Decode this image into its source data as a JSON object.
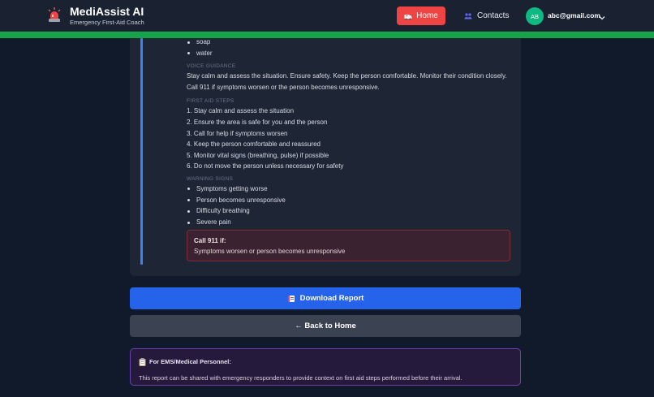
{
  "header": {
    "app_title": "MediAssist AI",
    "app_subtitle": "Emergency First-Aid Coach",
    "home_label": "Home",
    "contacts_label": "Contacts",
    "avatar_initials": "AB",
    "user_email": "abc@gmail.com"
  },
  "report": {
    "supplies": [
      "soap",
      "water"
    ],
    "voice_guidance": {
      "label": "VOICE GUIDANCE",
      "text": "Stay calm and assess the situation. Ensure safety. Keep the person comfortable. Monitor their condition closely. Call 911 if symptoms worsen or the person becomes unresponsive."
    },
    "first_aid": {
      "label": "FIRST AID STEPS",
      "steps": [
        "1. Stay calm and assess the situation",
        "2. Ensure the area is safe for you and the person",
        "3. Call for help if symptoms worsen",
        "4. Keep the person comfortable and reassured",
        "5. Monitor vital signs (breathing, pulse) if possible",
        "6. Do not move the person unless necessary for safety"
      ]
    },
    "warning_signs": {
      "label": "WARNING SIGNS",
      "items": [
        "Symptoms getting worse",
        "Person becomes unresponsive",
        "Difficulty breathing",
        "Severe pain"
      ]
    },
    "call_911": {
      "title": "Call 911 if:",
      "text": "Symptoms worsen or person becomes unresponsive"
    }
  },
  "actions": {
    "download_label": "Download Report",
    "back_label": "← Back to Home"
  },
  "ems": {
    "title": "For EMS/Medical Personnel:",
    "text": "This report can be shared with emergency responders to provide context on first aid steps performed before their arrival."
  },
  "icons": {
    "brand": "siren-icon",
    "home": "ambulance-icon",
    "contacts": "people-icon",
    "download": "book-icon",
    "ems": "clipboard-icon"
  },
  "colors": {
    "header_green": "#16a34a",
    "home_red": "#ef4444",
    "download_blue": "#2563eb",
    "accent_blue": "#3b82f6",
    "avatar_green": "#10b981",
    "ems_purple": "#6d3fb0",
    "alert_red": "#7f2d36"
  }
}
